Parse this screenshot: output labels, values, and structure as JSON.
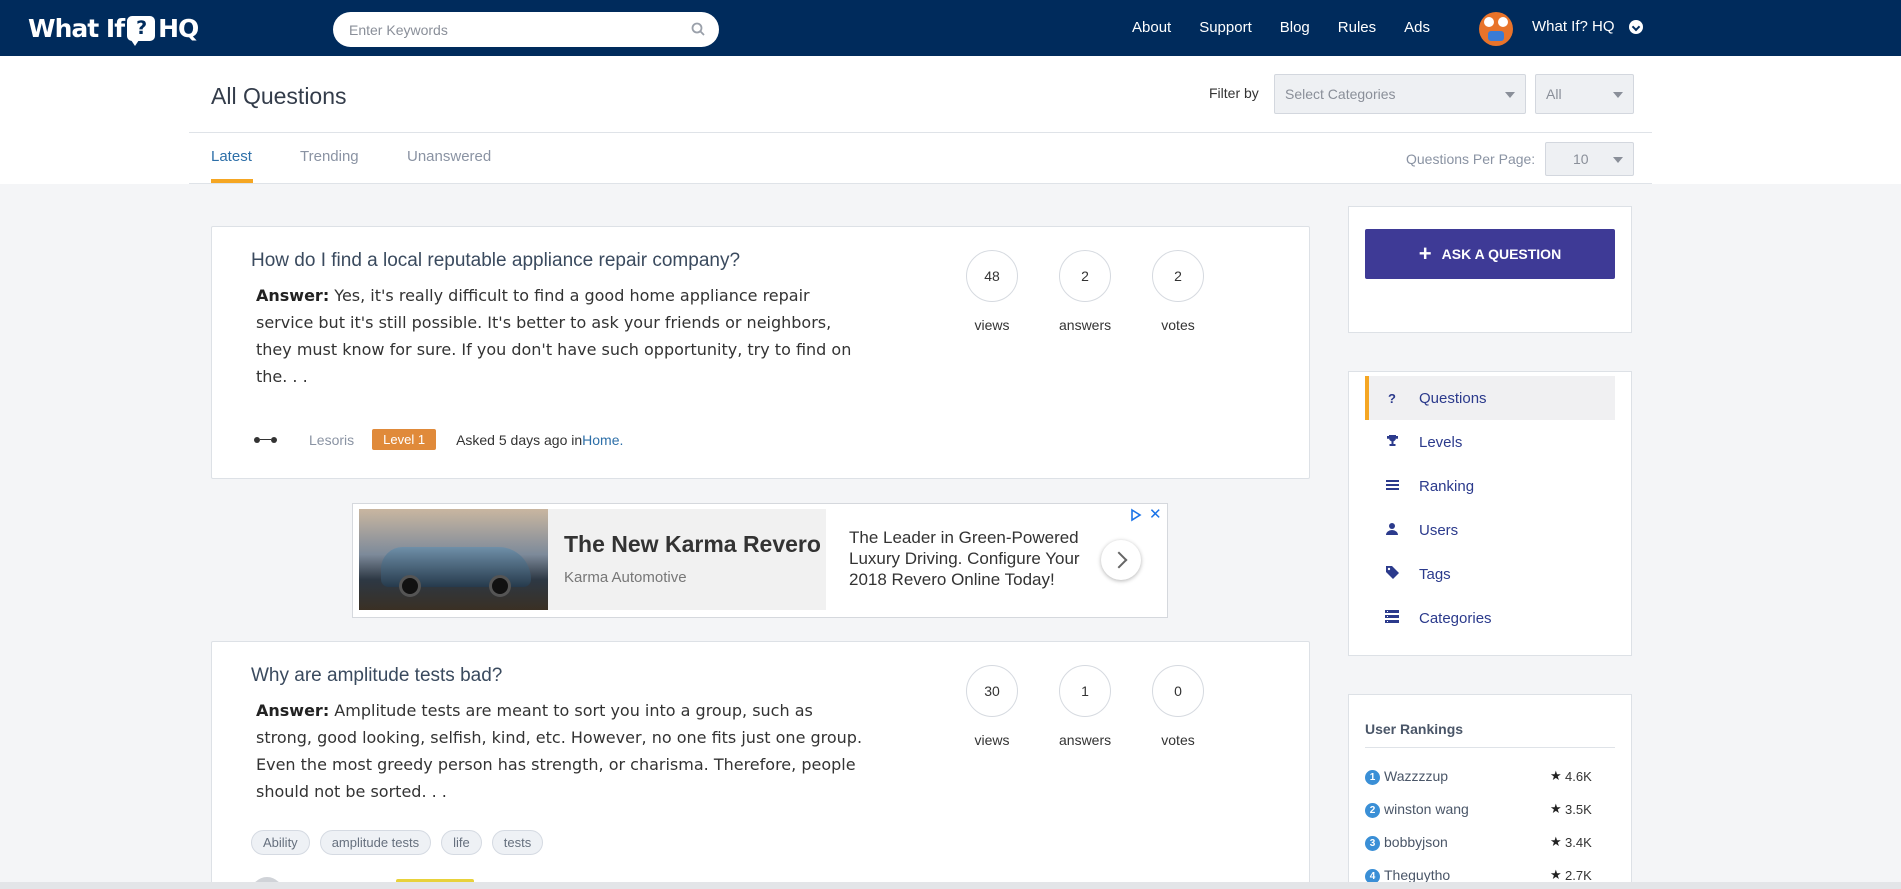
{
  "navbar": {
    "logo_text_left": "What If",
    "logo_bubble": "?",
    "logo_text_right": "HQ",
    "search_placeholder": "Enter Keywords",
    "links": [
      "About",
      "Support",
      "Blog",
      "Rules",
      "Ads"
    ],
    "user_name": "What If? HQ"
  },
  "header": {
    "title": "All Questions",
    "filter_label": "Filter by",
    "category_select": "Select Categories",
    "scope_select": "All",
    "tabs": [
      "Latest",
      "Trending",
      "Unanswered"
    ],
    "active_tab": "Latest",
    "per_page_label": "Questions Per Page:",
    "per_page_value": "10"
  },
  "questions": [
    {
      "title": "How do I find a local reputable appliance repair company?",
      "answer_label": "Answer:",
      "answer_text": " Yes, it's really difficult to find a good home appliance repair service but it's still possible. It's better to ask your friends or neighbors, they must know for sure. If you don't have such opportunity, try to find on the. . .",
      "views": "48",
      "views_label": "views",
      "answers": "2",
      "answers_label": "answers",
      "votes": "2",
      "votes_label": "votes",
      "user": "Lesoris",
      "level": "Level 1",
      "asked": "Asked 5 days ago in ",
      "category": "Home."
    },
    {
      "title": "Why are amplitude tests bad?",
      "answer_label": "Answer:",
      "answer_text": " Amplitude tests are meant to sort you into a group, such as strong, good looking, selfish, kind, etc. However, no one fits just one group. Even the most greedy person has strength, or charisma. Therefore, people should not be sorted. . .",
      "views": "30",
      "views_label": "views",
      "answers": "1",
      "answers_label": "answers",
      "votes": "0",
      "votes_label": "votes",
      "tags": [
        "Ability",
        "amplitude tests",
        "life",
        "tests"
      ]
    }
  ],
  "ad": {
    "headline": "The New Karma Revero",
    "brand": "Karma Automotive",
    "copy": "The Leader in Green-Powered Luxury Driving. Configure Your 2018 Revero Online Today!",
    "close": "✕"
  },
  "sidebar": {
    "ask_button": "ASK A QUESTION",
    "nav": [
      {
        "label": "Questions",
        "icon": "question-icon"
      },
      {
        "label": "Levels",
        "icon": "trophy-icon"
      },
      {
        "label": "Ranking",
        "icon": "list-icon"
      },
      {
        "label": "Users",
        "icon": "user-icon"
      },
      {
        "label": "Tags",
        "icon": "tag-icon"
      },
      {
        "label": "Categories",
        "icon": "categories-icon"
      }
    ],
    "rankings_title": "User Rankings",
    "rankings": [
      {
        "rank": "1",
        "name": "Wazzzzup",
        "score": "4.6K"
      },
      {
        "rank": "2",
        "name": "winston wang",
        "score": "3.5K"
      },
      {
        "rank": "3",
        "name": "bobbyjson",
        "score": "3.4K"
      },
      {
        "rank": "4",
        "name": "Theguytho",
        "score": "2.7K"
      }
    ]
  },
  "colors": {
    "navbar": "#002b5c",
    "accent_orange": "#f5a623",
    "ask_button": "#3e3a96",
    "link_blue": "#2d6fa8",
    "level_badge": "#e08a3a"
  }
}
